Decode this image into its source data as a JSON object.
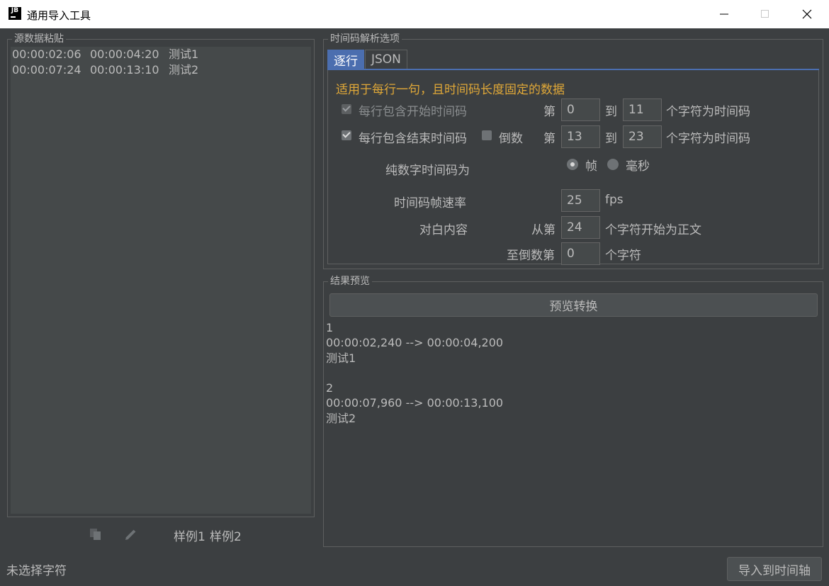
{
  "window": {
    "title": "通用导入工具",
    "app_icon_text": "JB"
  },
  "source": {
    "legend": "源数据粘贴",
    "lines": [
      {
        "start": "00:00:02:06",
        "end": "00:00:04:20",
        "text": "测试1"
      },
      {
        "start": "00:00:07:24",
        "end": "00:00:13:10",
        "text": "测试2"
      }
    ],
    "sample1": "样例1",
    "sample2": "样例2"
  },
  "status": {
    "text": "未选择字符"
  },
  "import_button": "导入到时间轴",
  "options": {
    "legend": "时间码解析选项",
    "tabs": [
      {
        "label": "逐行",
        "active": true
      },
      {
        "label": "JSON",
        "active": false
      }
    ],
    "hint": "适用于每行一句，且时间码长度固定的数据",
    "start_row": {
      "label": "每行包含开始时间码",
      "checked": true,
      "enabled": false,
      "di": "第",
      "from": "0",
      "to_label": "到",
      "to": "11",
      "suffix": "个字符为时间码"
    },
    "end_row": {
      "label": "每行包含结束时间码",
      "checked": true,
      "reverse_label": "倒数",
      "reverse_checked": false,
      "di": "第",
      "from": "13",
      "to_label": "到",
      "to": "23",
      "suffix": "个字符为时间码"
    },
    "numeric": {
      "label": "纯数字时间码为",
      "option_frame": "帧",
      "option_ms": "毫秒",
      "selected": "帧"
    },
    "fps": {
      "label": "时间码帧速率",
      "value": "25",
      "unit": "fps"
    },
    "dialog": {
      "label": "对白内容",
      "from_label": "从第",
      "from": "24",
      "from_suffix": "个字符开始为正文",
      "to_label": "至倒数第",
      "to": "0",
      "to_suffix": "个字符"
    }
  },
  "result": {
    "legend": "结果预览",
    "preview_button": "预览转换",
    "output": "1\n00:00:02,240 --> 00:00:04,200\n测试1\n\n2\n00:00:07,960 --> 00:00:13,100\n测试2"
  },
  "colors": {
    "background": "#3c3f41",
    "text": "#bbbbbb",
    "accent_tab": "#4b6eaf",
    "hint": "#e0a838"
  }
}
